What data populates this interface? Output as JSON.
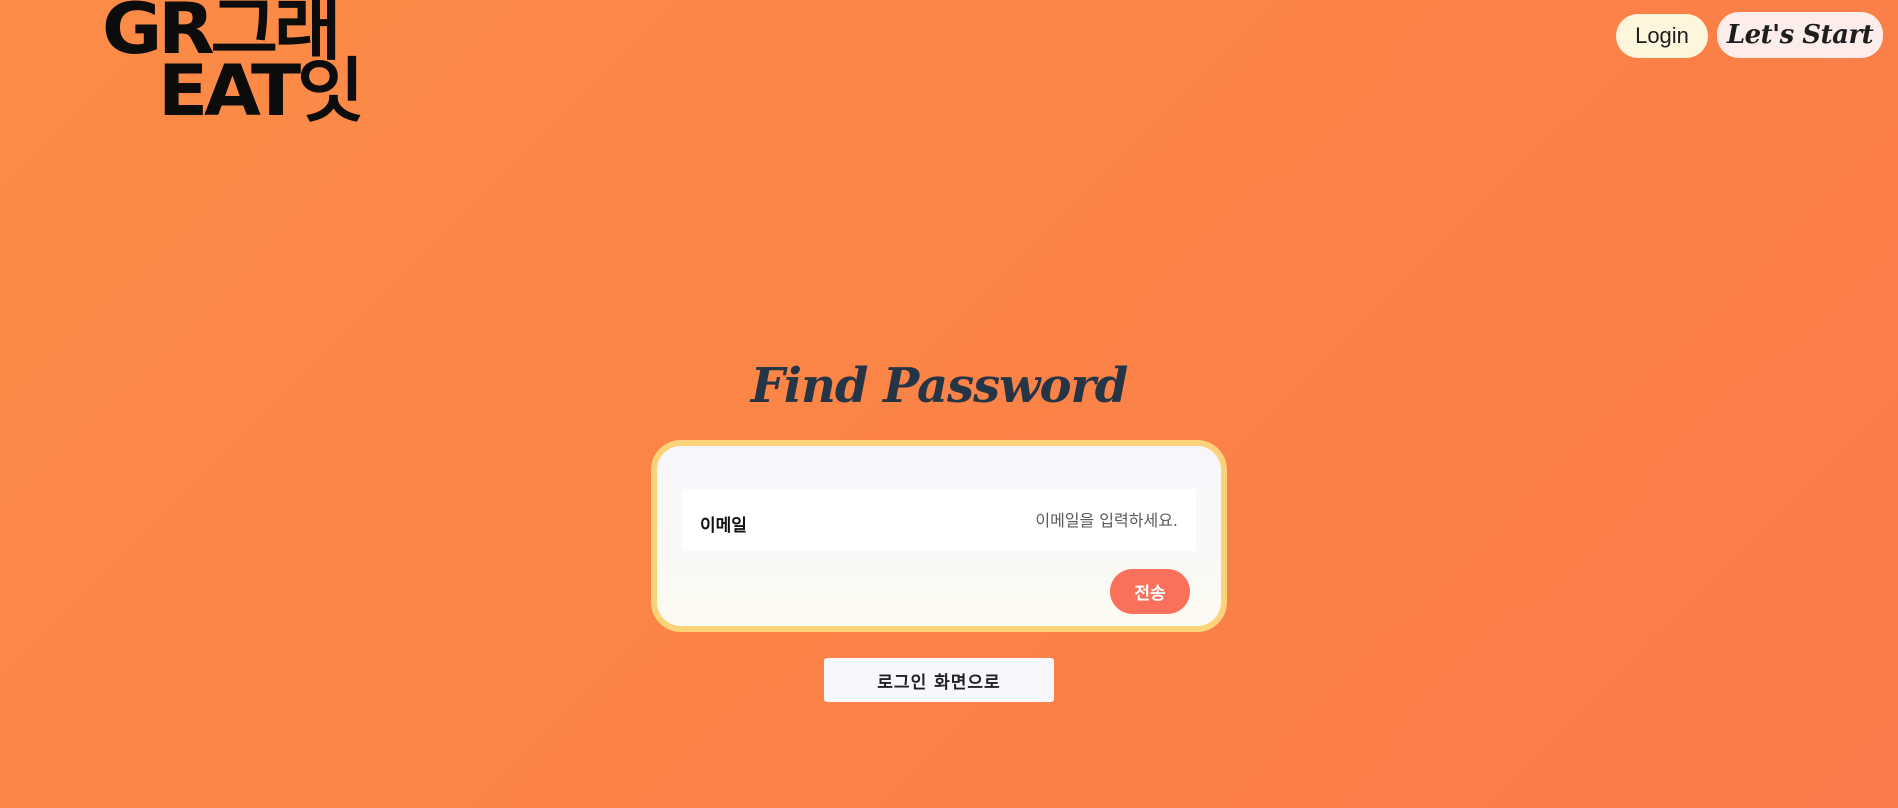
{
  "header": {
    "logo_line1": "GR그래",
    "logo_line2": "EAT잇",
    "login_label": "Login",
    "start_label": "Let's Start"
  },
  "main": {
    "title": "Find Password",
    "email_label": "이메일",
    "email_placeholder": "이메일을 입력하세요.",
    "email_value": "",
    "send_label": "전송",
    "back_label": "로그인 화면으로"
  },
  "colors": {
    "background": "#fb8347",
    "card_border": "#fdd37a",
    "send_button": "#fa705a",
    "title": "#263546"
  }
}
